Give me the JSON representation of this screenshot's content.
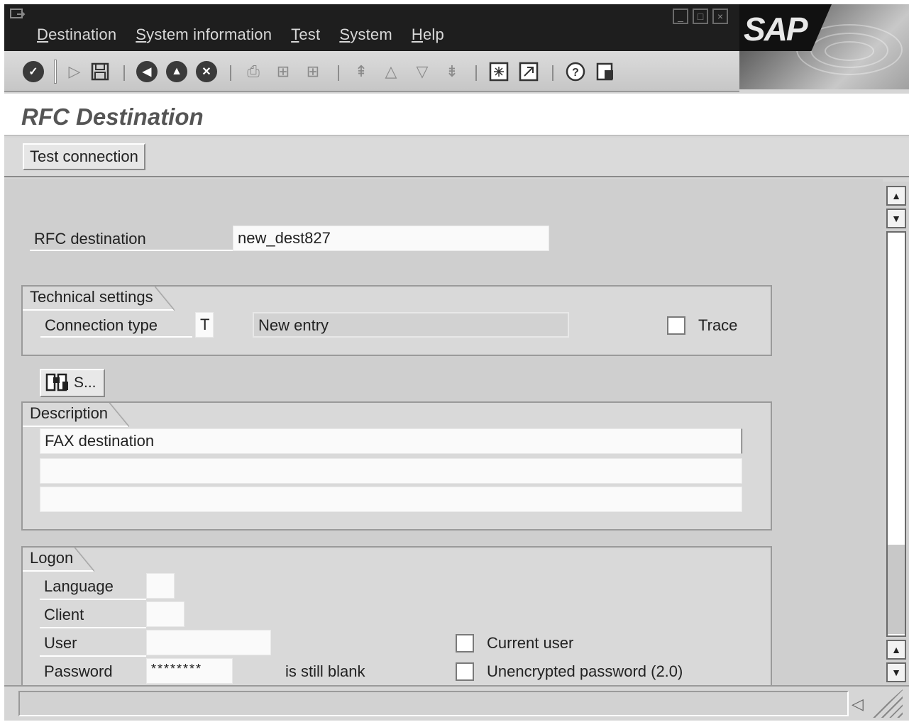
{
  "menu": {
    "items": [
      {
        "first": "D",
        "rest": "estination"
      },
      {
        "first": "S",
        "rest": "ystem information"
      },
      {
        "first": "T",
        "rest": "est"
      },
      {
        "first": "S",
        "rest": "ystem"
      },
      {
        "first": "H",
        "rest": "elp"
      }
    ],
    "logo_text": "SAP"
  },
  "toolbar": {
    "icons": [
      "enter-icon",
      "play-icon",
      "save-icon",
      "back-icon",
      "exit-icon",
      "cancel-icon",
      "print-icon",
      "find-icon",
      "find-next-icon",
      "first-page-icon",
      "previous-page-icon",
      "next-page-icon",
      "last-page-icon",
      "create-session-icon",
      "shortcut-icon",
      "help-icon",
      "layout-icon"
    ]
  },
  "page": {
    "title": "RFC Destination",
    "test_connection_label": "Test connection"
  },
  "form": {
    "rfc_destination_label": "RFC destination",
    "rfc_destination_value": "new_dest827",
    "technical": {
      "group_title": "Technical settings",
      "connection_type_label": "Connection type",
      "connection_type_value": "T",
      "connection_type_desc": "New entry",
      "trace_label": "Trace"
    },
    "search_button_label": "S...",
    "description": {
      "group_title": "Description",
      "line1": "FAX destination",
      "line2": "",
      "line3": ""
    },
    "logon": {
      "group_title": "Logon",
      "language_label": "Language",
      "client_label": "Client",
      "user_label": "User",
      "password_label": "Password",
      "password_value": "********",
      "password_note": "is still blank",
      "current_user_label": "Current user",
      "unencrypted_label": "Unencrypted password (2.0)"
    }
  }
}
